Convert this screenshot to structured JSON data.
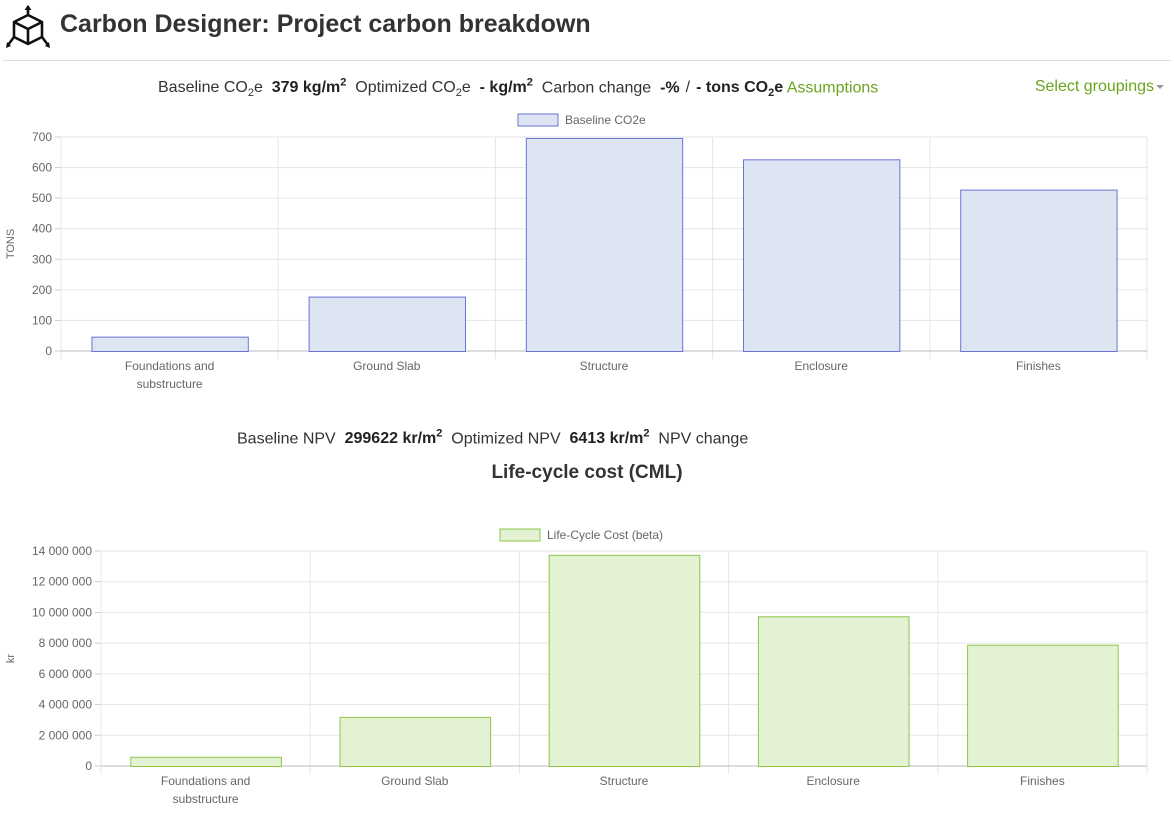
{
  "header": {
    "title": "Carbon Designer: Project carbon breakdown",
    "logo_icon": "isometric-box-icon"
  },
  "carbon_summary": {
    "baseline_label": "Baseline CO",
    "baseline_sub": "2",
    "baseline_suffix": "e",
    "baseline_value": "379 kg/m",
    "baseline_sup": "2",
    "optimized_label": "Optimized CO",
    "optimized_sub": "2",
    "optimized_suffix": "e",
    "optimized_value": "- kg/m",
    "optimized_sup": "2",
    "change_label": "Carbon change",
    "change_percent": "-%",
    "separator": "/",
    "change_tons": "- tons CO",
    "change_tons_sub": "2",
    "change_tons_suffix": "e",
    "assumptions_link": "Assumptions",
    "select_groupings": "Select groupings"
  },
  "npv_summary": {
    "baseline_label": "Baseline NPV",
    "baseline_value": "299622 kr/m",
    "baseline_sup": "2",
    "optimized_label": "Optimized NPV",
    "optimized_value": "6413 kr/m",
    "optimized_sup": "2",
    "change_label": "NPV change"
  },
  "chart_data": [
    {
      "type": "bar",
      "title": "",
      "categories": [
        [
          "Foundations and",
          "substructure"
        ],
        [
          "Ground Slab"
        ],
        [
          "Structure"
        ],
        [
          "Enclosure"
        ],
        [
          "Finishes"
        ]
      ],
      "series": [
        {
          "name": "Baseline CO2e",
          "values": [
            47,
            178,
            697,
            627,
            528
          ]
        }
      ],
      "xlabel": "",
      "ylabel": "TONS",
      "ylim": [
        0,
        700
      ],
      "yticks": [
        0,
        100,
        200,
        300,
        400,
        500,
        600,
        700
      ],
      "ytick_labels": [
        "0",
        "100",
        "200",
        "300",
        "400",
        "500",
        "600",
        "700"
      ],
      "grid": true,
      "legend": "top-center",
      "colors": {
        "fill": "#dde5f2",
        "stroke": "#6b73d6"
      }
    },
    {
      "type": "bar",
      "title": "Life-cycle cost (CML)",
      "categories": [
        [
          "Foundations and",
          "substructure"
        ],
        [
          "Ground Slab"
        ],
        [
          "Structure"
        ],
        [
          "Enclosure"
        ],
        [
          "Finishes"
        ]
      ],
      "series": [
        {
          "name": "Life-Cycle Cost (beta)",
          "values": [
            600000,
            3200000,
            13750000,
            9750000,
            7900000
          ]
        }
      ],
      "xlabel": "",
      "ylabel": "kr",
      "ylim": [
        0,
        14000000
      ],
      "yticks": [
        0,
        2000000,
        4000000,
        6000000,
        8000000,
        10000000,
        12000000,
        14000000
      ],
      "ytick_labels": [
        "0",
        "2 000 000",
        "4 000 000",
        "6 000 000",
        "8 000 000",
        "10 000 000",
        "12 000 000",
        "14 000 000"
      ],
      "grid": true,
      "legend": "top-center",
      "colors": {
        "fill": "#e3f2d2",
        "stroke": "#8dc64a"
      }
    }
  ]
}
